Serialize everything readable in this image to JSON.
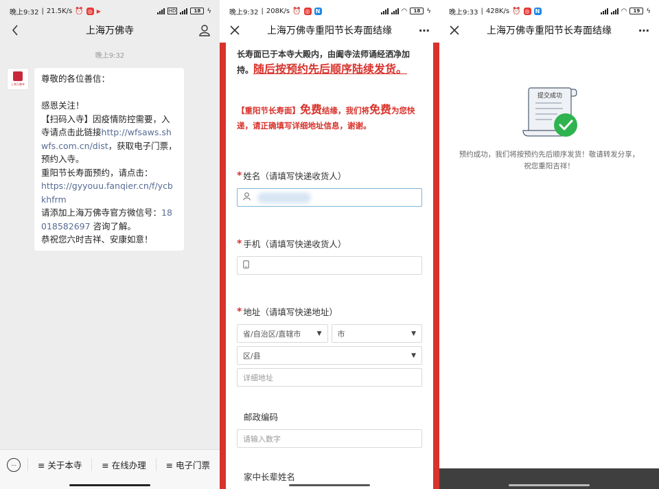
{
  "colors": {
    "accent_red": "#d8322b",
    "link_blue": "#576b95",
    "success_green": "#2fb350"
  },
  "panel1": {
    "status": {
      "time": "晚上9:32",
      "speed": "21.5K/s",
      "battery": "18",
      "net1": "5G",
      "net2": "5G"
    },
    "nav": {
      "title": "上海万佛寺",
      "back_icon": "back-icon",
      "profile_icon": "profile-icon"
    },
    "chat_time": "晚上9:32",
    "avatar_text": "上海万佛寺",
    "message": {
      "greeting": "尊敬的各位善信：",
      "thanks": "感恩关注！",
      "scan_text": "【扫码入寺】因疫情防控需要，入寺请点击此链接",
      "link1": "http://wfsaws.shwfs.com.cn/dist",
      "scan_text2": "，获取电子门票，预约入寺。",
      "longevity_text": "重阳节长寿面预约，请点击：",
      "link2": "https://gyyouu.fanqier.cn/f/ycbkhfrm",
      "wechat_text": "请添加上海万佛寺官方微信号：",
      "wechat_id": "18018582697",
      "wechat_text2": " 咨询了解。",
      "closing": "恭祝您六时吉祥、安康如意！"
    },
    "menu": [
      "≡ 关于本寺",
      "≡ 在线办理",
      "≡ 电子门票"
    ]
  },
  "panel2": {
    "status": {
      "time": "晚上9:32",
      "speed": "208K/s",
      "battery": "18"
    },
    "nav": {
      "title": "上海万佛寺重阳节长寿面结缘",
      "close_icon": "close-icon",
      "more_icon": "more-icon"
    },
    "notice1_text": "长寿面已于本寺大殿内，由阖寺法师诵经洒净加持。",
    "notice1_red": "随后按预约先后顺序陆续发货。",
    "notice2_a": "【重阳节长寿面】",
    "notice2_b": "免费",
    "notice2_c": "结缘，我们将",
    "notice2_d": "免费",
    "notice2_e": "为您快递，请正确填写详细地址信息，谢谢。",
    "fields": {
      "name_label": "姓名（请填写快递收货人）",
      "phone_label": "手机（请填写快递收货人）",
      "address_label": "地址（请填写快递地址）",
      "province_placeholder": "省/自治区/直辖市",
      "city_placeholder": "市",
      "district_placeholder": "区/县",
      "detail_placeholder": "详细地址",
      "postcode_label": "邮政编码",
      "postcode_placeholder": "请输入数字",
      "elder_label": "家中长辈姓名"
    }
  },
  "panel3": {
    "status": {
      "time": "晚上9:33",
      "speed": "428K/s",
      "battery": "19"
    },
    "nav": {
      "title": "上海万佛寺重阳节长寿面结缘",
      "close_icon": "close-icon",
      "more_icon": "more-icon"
    },
    "doc_title": "提交成功",
    "success_text": "预约成功，我们将按预约先后顺序发货！敬请转发分享，祝您重阳吉祥！"
  }
}
